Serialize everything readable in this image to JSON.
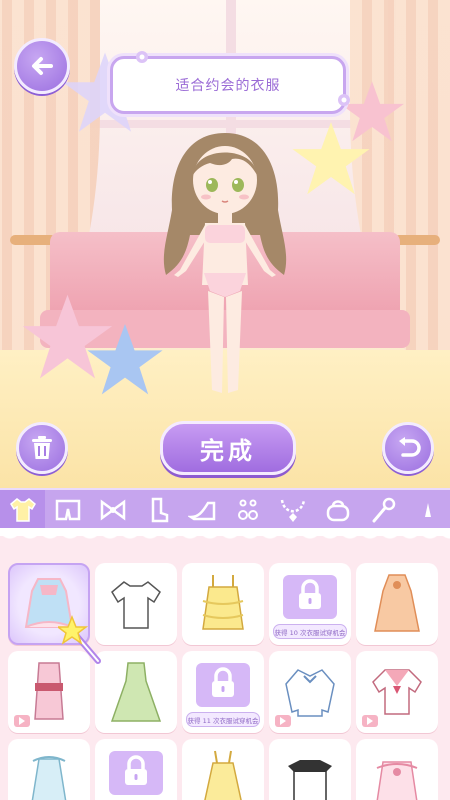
{
  "header": {
    "title": "适合约会的衣服"
  },
  "actions": {
    "done_label": "完成"
  },
  "categories": [
    {
      "icon": "top-icon",
      "active": true
    },
    {
      "icon": "bottoms-icon",
      "active": false
    },
    {
      "icon": "bow-icon",
      "active": false
    },
    {
      "icon": "socks-icon",
      "active": false
    },
    {
      "icon": "high-heel-icon",
      "active": false
    },
    {
      "icon": "earrings-icon",
      "active": false
    },
    {
      "icon": "necklace-icon",
      "active": false
    },
    {
      "icon": "handbag-icon",
      "active": false
    },
    {
      "icon": "wand-icon",
      "active": false
    },
    {
      "icon": "more-icon",
      "active": false
    }
  ],
  "items": [
    {
      "type": "outfit",
      "name": "lolita-dress-blue",
      "selected": true
    },
    {
      "type": "outfit",
      "name": "white-tshirt"
    },
    {
      "type": "outfit",
      "name": "yellow-ruffle-cami"
    },
    {
      "type": "locked",
      "unlock_text": "获得 10 次衣服试穿机会"
    },
    {
      "type": "outfit",
      "name": "orange-qipao-dress"
    },
    {
      "type": "outfit",
      "name": "pink-kimono",
      "video": true
    },
    {
      "type": "outfit",
      "name": "green-gown"
    },
    {
      "type": "locked",
      "unlock_text": "获得 11 次衣服试穿机会"
    },
    {
      "type": "outfit",
      "name": "white-ribbon-blouse",
      "video": true
    },
    {
      "type": "outfit",
      "name": "sailor-top",
      "video": true
    },
    {
      "type": "outfit",
      "name": "blue-frill-dress"
    },
    {
      "type": "locked",
      "unlock_text": ""
    },
    {
      "type": "outfit",
      "name": "yellow-dress"
    },
    {
      "type": "outfit",
      "name": "black-white-top"
    },
    {
      "type": "outfit",
      "name": "pink-frill-top"
    }
  ],
  "colors": {
    "accent": "#a06de0",
    "category_bar": "#c6a5ee",
    "background": "#fde9ef"
  }
}
